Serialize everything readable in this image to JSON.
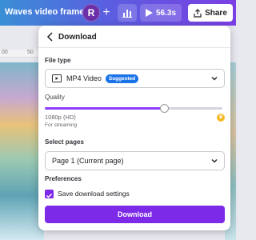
{
  "topbar": {
    "title": "Waves video frame",
    "avatar_initial": "R",
    "plus_glyph": "+",
    "play_duration": "56.3s",
    "share_label": "Share"
  },
  "ruler": {
    "ticks": [
      "00",
      "50"
    ]
  },
  "panel": {
    "title": "Download",
    "file_type": {
      "label": "File type",
      "value": "MP4 Video",
      "badge": "Suggested"
    },
    "quality": {
      "label": "Quality",
      "resolution": "1080p (HD)",
      "subtext": "For streaming",
      "level": 0.67
    },
    "select_pages": {
      "label": "Select pages",
      "value": "Page 1 (Current page)"
    },
    "preferences": {
      "label": "Preferences",
      "save_settings": "Save download settings",
      "checked": true
    },
    "download_button": "Download"
  },
  "colors": {
    "accent": "#7d2ae8",
    "badge": "#1a73e8",
    "crown": "#f5b826"
  },
  "icons": [
    "back-chevron-icon",
    "video-file-icon",
    "chevron-down-icon",
    "crown-icon",
    "checkmark-icon",
    "play-icon",
    "stats-icon",
    "share-upload-icon"
  ]
}
